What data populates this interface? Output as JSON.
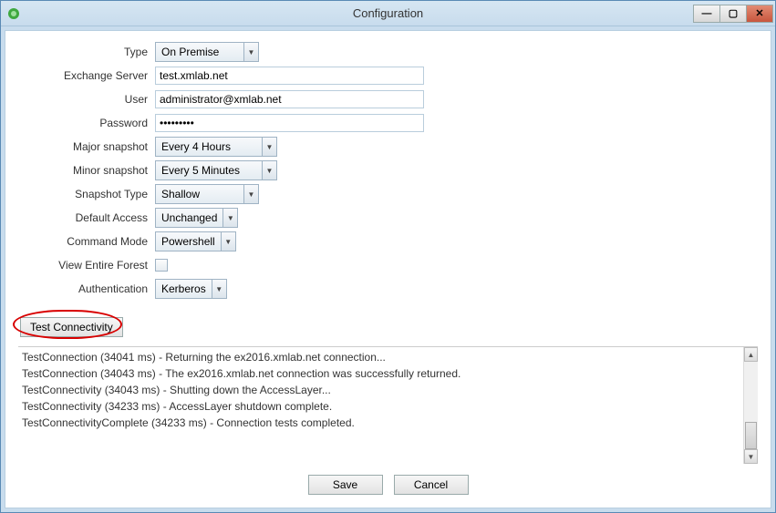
{
  "window": {
    "title": "Configuration"
  },
  "form": {
    "type": {
      "label": "Type",
      "value": "On Premise"
    },
    "exchange_server": {
      "label": "Exchange Server",
      "value": "test.xmlab.net"
    },
    "user": {
      "label": "User",
      "value": "administrator@xmlab.net"
    },
    "password": {
      "label": "Password",
      "value": "•••••••••"
    },
    "major_snapshot": {
      "label": "Major snapshot",
      "value": "Every 4 Hours"
    },
    "minor_snapshot": {
      "label": "Minor snapshot",
      "value": "Every 5 Minutes"
    },
    "snapshot_type": {
      "label": "Snapshot Type",
      "value": "Shallow"
    },
    "default_access": {
      "label": "Default Access",
      "value": "Unchanged"
    },
    "command_mode": {
      "label": "Command Mode",
      "value": "Powershell"
    },
    "view_entire_forest": {
      "label": "View Entire Forest",
      "checked": false
    },
    "authentication": {
      "label": "Authentication",
      "value": "Kerberos"
    }
  },
  "buttons": {
    "test_connectivity": "Test Connectivity",
    "save": "Save",
    "cancel": "Cancel"
  },
  "log": {
    "lines": [
      "TestConnection (34041 ms) - Returning the ex2016.xmlab.net connection...",
      "TestConnection (34043 ms) - The ex2016.xmlab.net connection was successfully returned.",
      "TestConnectivity (34043 ms) - Shutting down the AccessLayer...",
      "TestConnectivity (34233 ms) - AccessLayer shutdown complete.",
      "TestConnectivityComplete (34233 ms) - Connection tests completed."
    ]
  }
}
